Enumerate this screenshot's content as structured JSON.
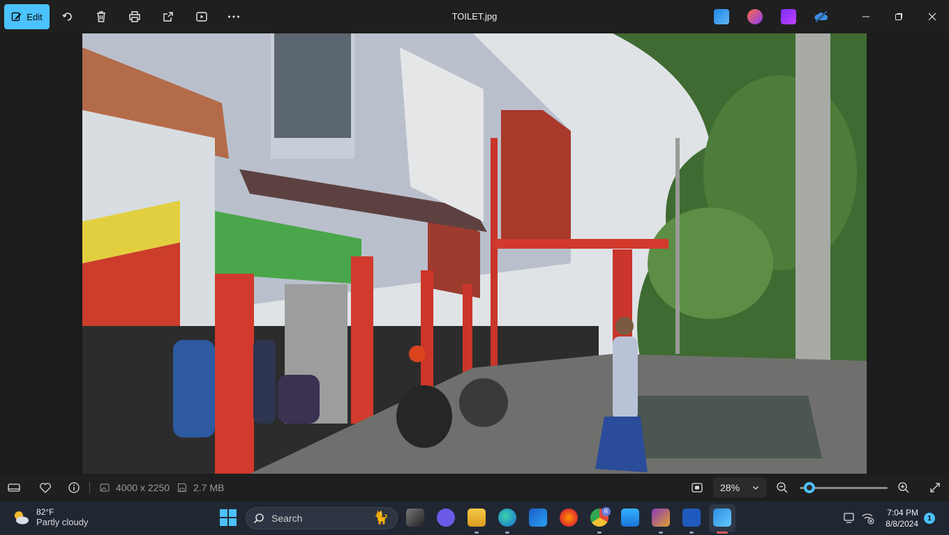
{
  "toolbar": {
    "edit_label": "Edit",
    "title": "TOILET.jpg"
  },
  "infobar": {
    "dimensions": "4000 x 2250",
    "file_size": "2.7 MB",
    "zoom": "28%",
    "zoom_slider_fraction": 0.05
  },
  "taskbar": {
    "weather_temp": "82°F",
    "weather_desc": "Partly cloudy",
    "search_label": "Search",
    "time": "7:04 PM",
    "date": "8/8/2024",
    "notification_count": "1",
    "chrome_badge": "R"
  },
  "colors": {
    "accent": "#4cc2ff",
    "background": "#1c1c1c",
    "taskbar": "#202733"
  }
}
